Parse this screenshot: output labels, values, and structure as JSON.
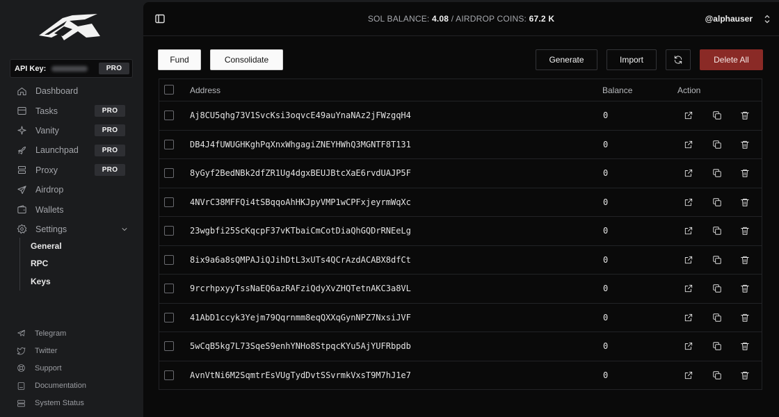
{
  "sidebar": {
    "api_key_label": "API Key:",
    "api_key_badge": "PRO",
    "nav": [
      {
        "label": "Dashboard",
        "icon": "home-icon",
        "badge": ""
      },
      {
        "label": "Tasks",
        "icon": "tasks-icon",
        "badge": "PRO"
      },
      {
        "label": "Vanity",
        "icon": "sparkle-icon",
        "badge": "PRO"
      },
      {
        "label": "Launchpad",
        "icon": "rocket-icon",
        "badge": "PRO"
      },
      {
        "label": "Proxy",
        "icon": "proxy-icon",
        "badge": "PRO"
      },
      {
        "label": "Airdrop",
        "icon": "send-icon",
        "badge": ""
      },
      {
        "label": "Wallets",
        "icon": "wallet-icon",
        "badge": ""
      },
      {
        "label": "Settings",
        "icon": "gear-icon",
        "badge": ""
      }
    ],
    "settings_sub": [
      "General",
      "RPC",
      "Keys"
    ],
    "footer": [
      {
        "label": "Telegram",
        "icon": "telegram-icon"
      },
      {
        "label": "Twitter",
        "icon": "twitter-icon"
      },
      {
        "label": "Support",
        "icon": "support-icon"
      },
      {
        "label": "Documentation",
        "icon": "book-icon"
      },
      {
        "label": "System Status",
        "icon": "server-icon"
      }
    ]
  },
  "header": {
    "sol_label": "SOL BALANCE:",
    "sol_value": "4.08",
    "separator": "/",
    "airdrop_label": "AIRDROP COINS:",
    "airdrop_value": "67.2 K",
    "username": "@alphauser"
  },
  "toolbar": {
    "fund": "Fund",
    "consolidate": "Consolidate",
    "generate": "Generate",
    "import": "Import",
    "refresh_icon": "refresh-icon",
    "delete_all": "Delete All"
  },
  "table": {
    "columns": [
      "Address",
      "Balance",
      "Action"
    ],
    "rows": [
      {
        "address": "Aj8CU5qhg73V1SvcKsi3oqvcE49auYnaNAz2jFWzgqH4",
        "balance": "0"
      },
      {
        "address": "DB4J4fUWUGHKghPqXnxWhgagiZNEYHWhQ3MGNTF8T131",
        "balance": "0"
      },
      {
        "address": "8yGyf2BedNBk2dfZR1Ug4dgxBEUJBtcXaE6rvdUAJP5F",
        "balance": "0"
      },
      {
        "address": "4NVrC38MFFQi4tSBqqoAhHKJpyVMP1wCPFxjeyrmWqXc",
        "balance": "0"
      },
      {
        "address": "23wgbfi25ScKqcpF37vKTbaiCmCotDiaQhGQDrRNEeLg",
        "balance": "0"
      },
      {
        "address": "8ix9a6a8sQMPAJiQJihDtL3xUTs4QCrAzdACABX8dfCt",
        "balance": "0"
      },
      {
        "address": "9rcrhpxyyTssNaEQ6azRAFziQdyXvZHQTetnAKC3a8VL",
        "balance": "0"
      },
      {
        "address": "41AbD1ccyk3Yejm79Qqrnmm8eqQXXqGynNPZ7NxsiJVF",
        "balance": "0"
      },
      {
        "address": "5wCqB5kg7L73SqeS9enhYNHo8StpqcKYu5AjYUFRbpdb",
        "balance": "0"
      },
      {
        "address": "AvnVtNi6M2SqmtrEsVUgTydDvtSSvrmkVxsT9M7hJ1e7",
        "balance": "0"
      }
    ]
  },
  "colors": {
    "background": "#0a0a0a",
    "sidebar": "#1b1c1e",
    "danger": "#8a2a26"
  }
}
